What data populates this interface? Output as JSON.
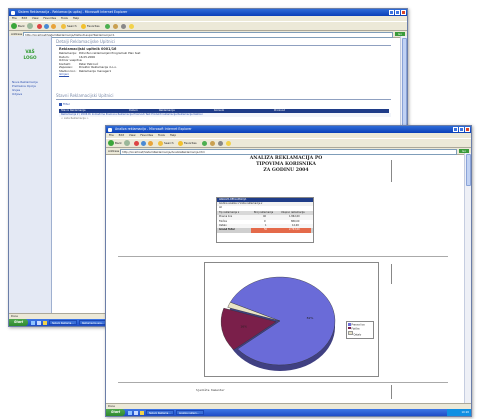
{
  "back_window": {
    "title": "Sistem Reklamacija - Reklamacija upitaj - Microsoft Internet Explorer",
    "menu": [
      "File",
      "Edit",
      "View",
      "Favorites",
      "Tools",
      "Help"
    ],
    "toolbar": {
      "back": "Back",
      "search": "Search",
      "favorites": "Favorites"
    },
    "address_label": "Address",
    "address": "http://localhost/SistemReklamacija/Default.aspx?Reklamacija=1",
    "go": "Go",
    "logo_line1": "VAŠ",
    "logo_line2": "LOGO",
    "sidebar": [
      "Nove Reklamacije",
      "Pretrazna Opcija",
      "Izvjes",
      "Odjava"
    ],
    "section1_title": "Detalji Reklamacijske Upitnici",
    "record_title": "Reklamacijski upitnik 0001/16",
    "fields": [
      {
        "k": "Reklamacija:",
        "v": "Potvrđen reklamacijski Programski Plan test"
      },
      {
        "k": "Datum:",
        "v": "16.05.2006"
      },
      {
        "k": "Odmor vaspitna:",
        "v": ""
      },
      {
        "k": "Kontakt:",
        "v": "Petar Petrović"
      },
      {
        "k": "Zaposlen:",
        "v": "Direktor Reklamacije d.o.o."
      },
      {
        "k": "Stadion kor.:",
        "v": "Reklamacije manager1"
      }
    ],
    "small_link": "Izmjeni",
    "section2_title": "Stavni Reklamacijski Upitnici",
    "table_link": "Filter",
    "table_headers": [
      "Stavni Reklamacije",
      "Datum",
      "Reklamacija",
      "Korisnik",
      "Proizvod"
    ],
    "table_row": "Reklamacija 2 / 2006  Po komadima  Poslovna Reklamacija Proizvodi Test Produkti reklamacije Reklamacije Kablovi",
    "row2": "< Lista Reklamacija >",
    "status": "Done",
    "taskbar": {
      "start": "Start",
      "items": [
        "Sistem Reklama...",
        "Reklamacija ana..."
      ],
      "clock": "10:19"
    }
  },
  "front_window": {
    "title": "Analiza reklamacija - Microsoft Internet Explorer",
    "menu": [
      "File",
      "Edit",
      "View",
      "Favorites",
      "Tools",
      "Help"
    ],
    "toolbar": {
      "back": "Back",
      "search": "Search",
      "favorites": "Favorites"
    },
    "address_label": "Address",
    "address": "http://localhost/SistemReklamacija/AnalizaReklamacija.htm",
    "go": "Go",
    "report_title": [
      "ANALIZA REKLAMACIJA PO",
      "TIPOVIMA KORISNIKA",
      "ZA GODINU 2004"
    ],
    "pivot": {
      "header": "ANALIZA REKLAMACIJA",
      "filter": "Godina analize ▾  Vrsta reklamacije ▾",
      "filter_val": "All",
      "cols": [
        "Tip reklamacije ▾",
        "Broj reklamacija",
        "Ukupno reklamacija"
      ],
      "rows": [
        {
          "k": "Pravna lica",
          "a": "40",
          "b": "1.862,00"
        },
        {
          "k": "Fizička",
          "a": "9",
          "b": "889,00"
        },
        {
          "k": "Ostalo",
          "a": "1",
          "b": "12,00"
        },
        {
          "k": "Grand Total",
          "a": "50",
          "b": "2.763,00"
        }
      ]
    },
    "chart_data": {
      "type": "pie",
      "labels": [
        "Pravna lica",
        "Fizička",
        "Ostalo"
      ],
      "values": [
        82,
        16,
        2
      ],
      "slice_labels": [
        "82%",
        "16%",
        ""
      ],
      "colors": [
        "#6a6bd8",
        "#7a1f4a",
        "#e9e4c6"
      ],
      "legend_position": "right"
    },
    "footer_text": "Sjedište Komentar",
    "status": "Done",
    "taskbar": {
      "start": "Start",
      "items": [
        "Sistem Reklama...",
        "Analiza reklam..."
      ],
      "clock": "10:20"
    }
  }
}
